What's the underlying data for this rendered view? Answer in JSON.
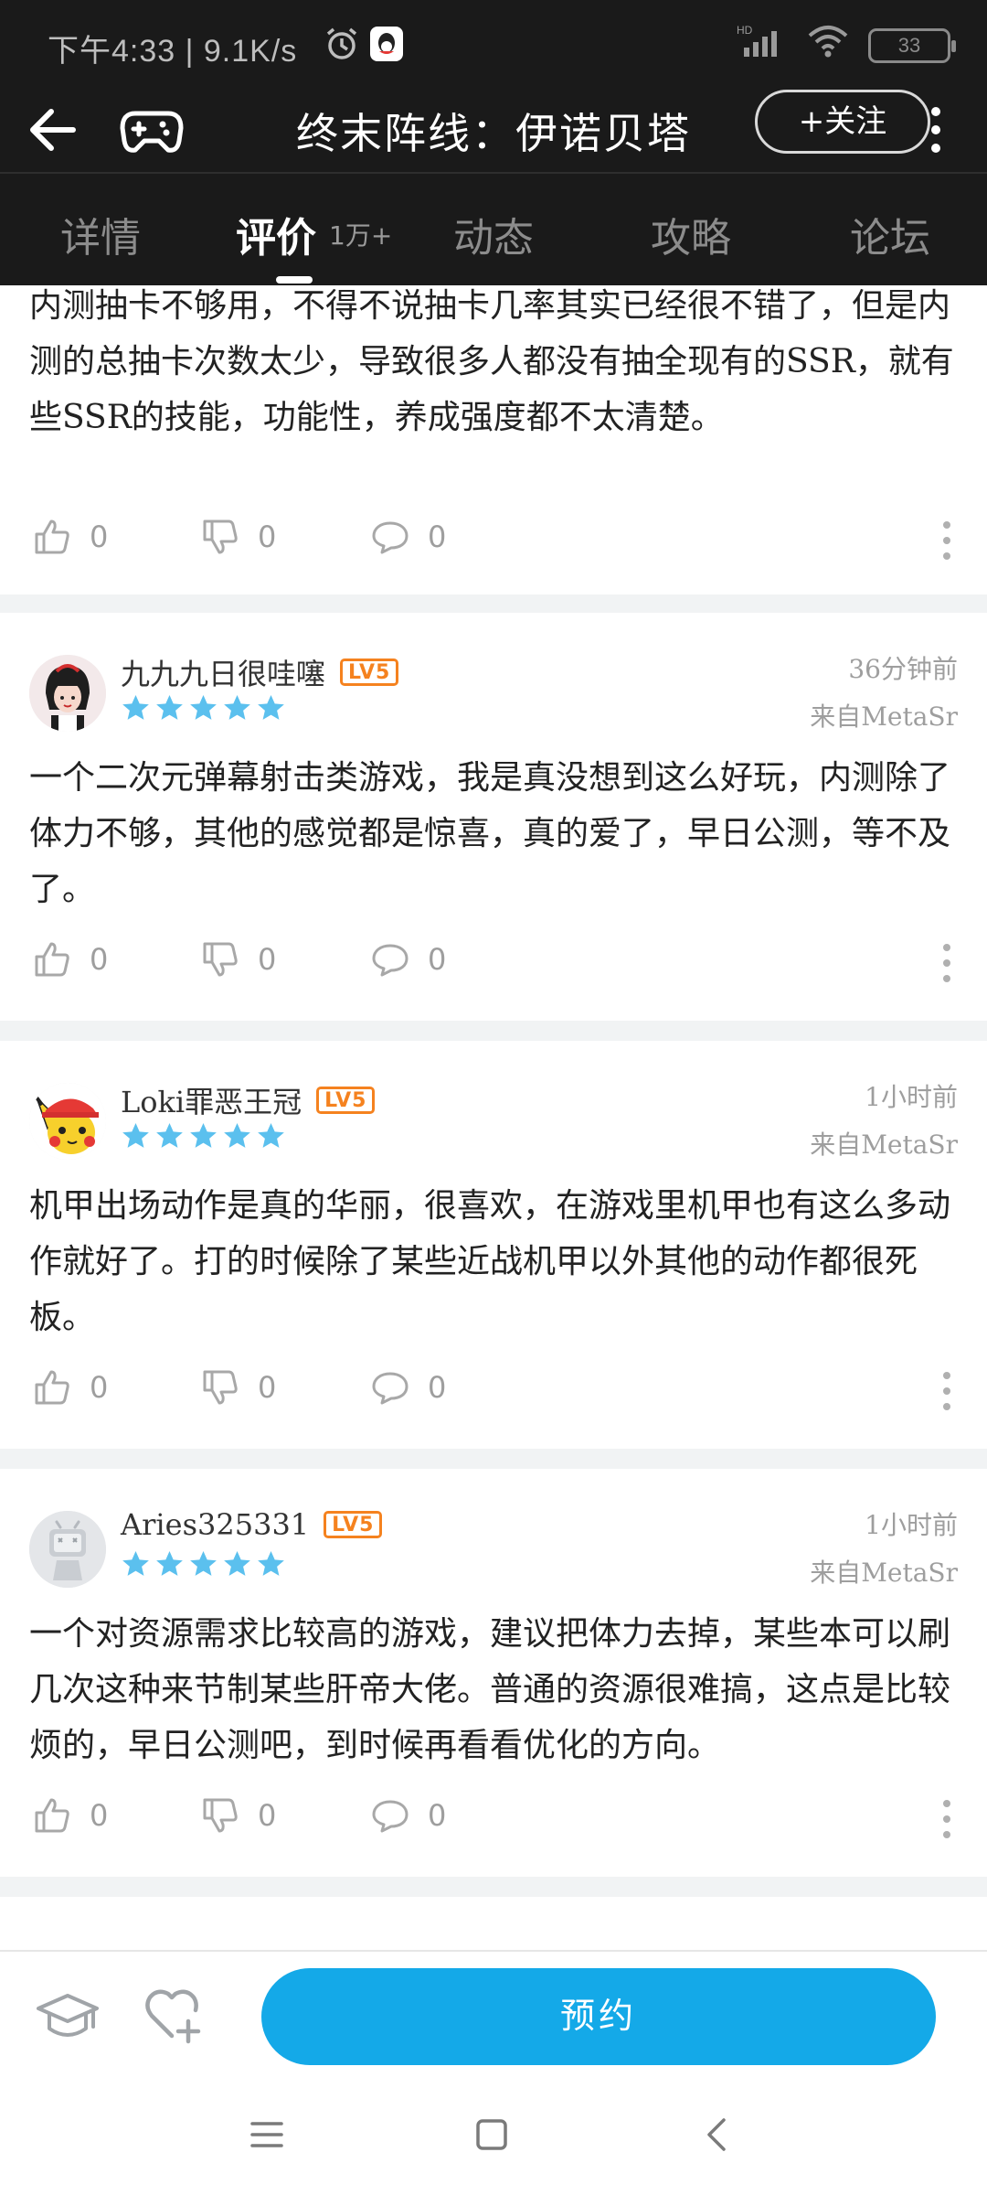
{
  "status_bar": {
    "time": "下午4:33 | 9.1K/s",
    "network": "HD",
    "battery": "33"
  },
  "header": {
    "title": "终末阵线：伊诺贝塔",
    "follow_label": "+关注"
  },
  "tabs": [
    {
      "label": "详情",
      "active": false
    },
    {
      "label": "评价",
      "count": "1万+",
      "active": true
    },
    {
      "label": "动态",
      "active": false
    },
    {
      "label": "攻略",
      "active": false
    },
    {
      "label": "论坛",
      "active": false
    }
  ],
  "reviews": [
    {
      "text": "内测抽卡不够用，不得不说抽卡几率其实已经很不错了，但是内测的总抽卡次数太少，导致很多人都没有抽全现有的SSR，就有些SSR的技能，功能性，养成强度都不太清楚。",
      "likes": "0",
      "dislikes": "0",
      "comments": "0"
    },
    {
      "username": "九九九日很哇噻",
      "level": "LV5",
      "rating": 5,
      "time": "36分钟前",
      "source": "来自MetaSr",
      "text": "一个二次元弹幕射击类游戏，我是真没想到这么好玩，内测除了体力不够，其他的感觉都是惊喜，真的爱了，早日公测，等不及了。",
      "likes": "0",
      "dislikes": "0",
      "comments": "0"
    },
    {
      "username": "Loki罪恶王冠",
      "level": "LV5",
      "rating": 5,
      "time": "1小时前",
      "source": "来自MetaSr",
      "text": "机甲出场动作是真的华丽，很喜欢，在游戏里机甲也有这么多动作就好了。打的时候除了某些近战机甲以外其他的动作都很死板。",
      "likes": "0",
      "dislikes": "0",
      "comments": "0"
    },
    {
      "username": "Aries325331",
      "level": "LV5",
      "rating": 5,
      "time": "1小时前",
      "source": "来自MetaSr",
      "text": "一个对资源需求比较高的游戏，建议把体力去掉，某些本可以刷几次这种来节制某些肝帝大佬。普通的资源很难搞，这点是比较烦的，早日公测吧，到时候再看看优化的方向。",
      "likes": "0",
      "dislikes": "0",
      "comments": "0"
    }
  ],
  "bottom_bar": {
    "reserve_label": "预约"
  },
  "colors": {
    "accent": "#14a9e8",
    "star": "#5bc0ee",
    "level_badge": "#f5821f",
    "header_bg": "#1a1a1a"
  }
}
